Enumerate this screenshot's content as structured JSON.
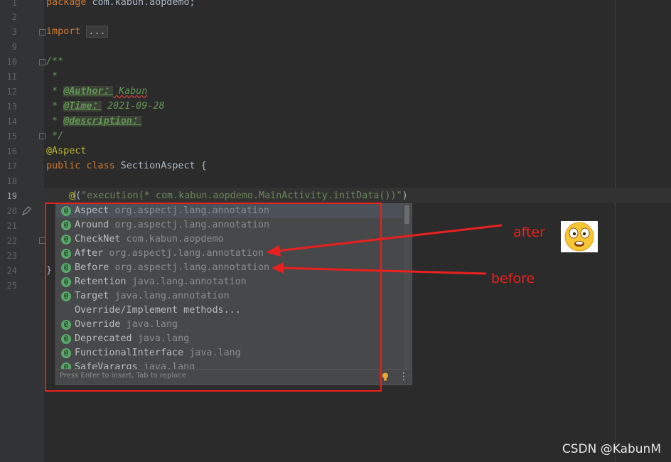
{
  "editor": {
    "line_numbers": [
      "1",
      "2",
      "3",
      "9",
      "10",
      "11",
      "12",
      "13",
      "14",
      "15",
      "16",
      "17",
      "18",
      "19",
      "20",
      "21",
      "22",
      "23",
      "24",
      "25"
    ],
    "current_line": "19",
    "code": {
      "l1_kw": "package",
      "l1_rest": " com.kabun.aopdemo;",
      "l3_kw": "import",
      "l3_fold": "...",
      "l10": "/**",
      "l11": " *",
      "l12_star": " * ",
      "l12_tag": "@Author：",
      "l12_val": " Kabun",
      "l13_star": " * ",
      "l13_tag": "@Time：",
      "l13_val": " 2021-09-28",
      "l14_star": " * ",
      "l14_tag": "@description：",
      "l15": " */",
      "l16": "@Aspect",
      "l17_kw1": "public",
      "l17_kw2": "class",
      "l17_rest": " SectionAspect {",
      "l19_at": "@",
      "l19_paren": "(",
      "l19_str": "\"execution(* com.kabun.aopdemo.MainActivity.initData())\"",
      "l19_close": ")",
      "l24": "}"
    }
  },
  "popup": {
    "items": [
      {
        "name": "Aspect",
        "pkg": "org.aspectj.lang.annotation",
        "icon": "annotation-icon"
      },
      {
        "name": "Around",
        "pkg": "org.aspectj.lang.annotation",
        "icon": "annotation-icon"
      },
      {
        "name": "CheckNet",
        "pkg": "com.kabun.aopdemo",
        "icon": "annotation-icon"
      },
      {
        "name": "After",
        "pkg": "org.aspectj.lang.annotation",
        "icon": "annotation-icon"
      },
      {
        "name": "Before",
        "pkg": "org.aspectj.lang.annotation",
        "icon": "annotation-icon"
      },
      {
        "name": "Retention",
        "pkg": "java.lang.annotation",
        "icon": "annotation-icon"
      },
      {
        "name": "Target",
        "pkg": "java.lang.annotation",
        "icon": "annotation-icon"
      },
      {
        "name": "Override/Implement methods...",
        "pkg": "",
        "icon": ""
      },
      {
        "name": "Override",
        "pkg": "java.lang",
        "icon": "annotation-icon"
      },
      {
        "name": "Deprecated",
        "pkg": "java.lang",
        "icon": "annotation-icon"
      },
      {
        "name": "FunctionalInterface",
        "pkg": "java.lang",
        "icon": "annotation-icon"
      },
      {
        "name": "SafeVarargs",
        "pkg": "java.lang",
        "icon": "annotation-icon"
      }
    ],
    "icon_glyph": "@",
    "hint": "Press Enter to insert, Tab to replace"
  },
  "annotations": {
    "after_label": "after",
    "before_label": "before",
    "color": "#e8201e"
  },
  "watermark": "CSDN @KabunM"
}
